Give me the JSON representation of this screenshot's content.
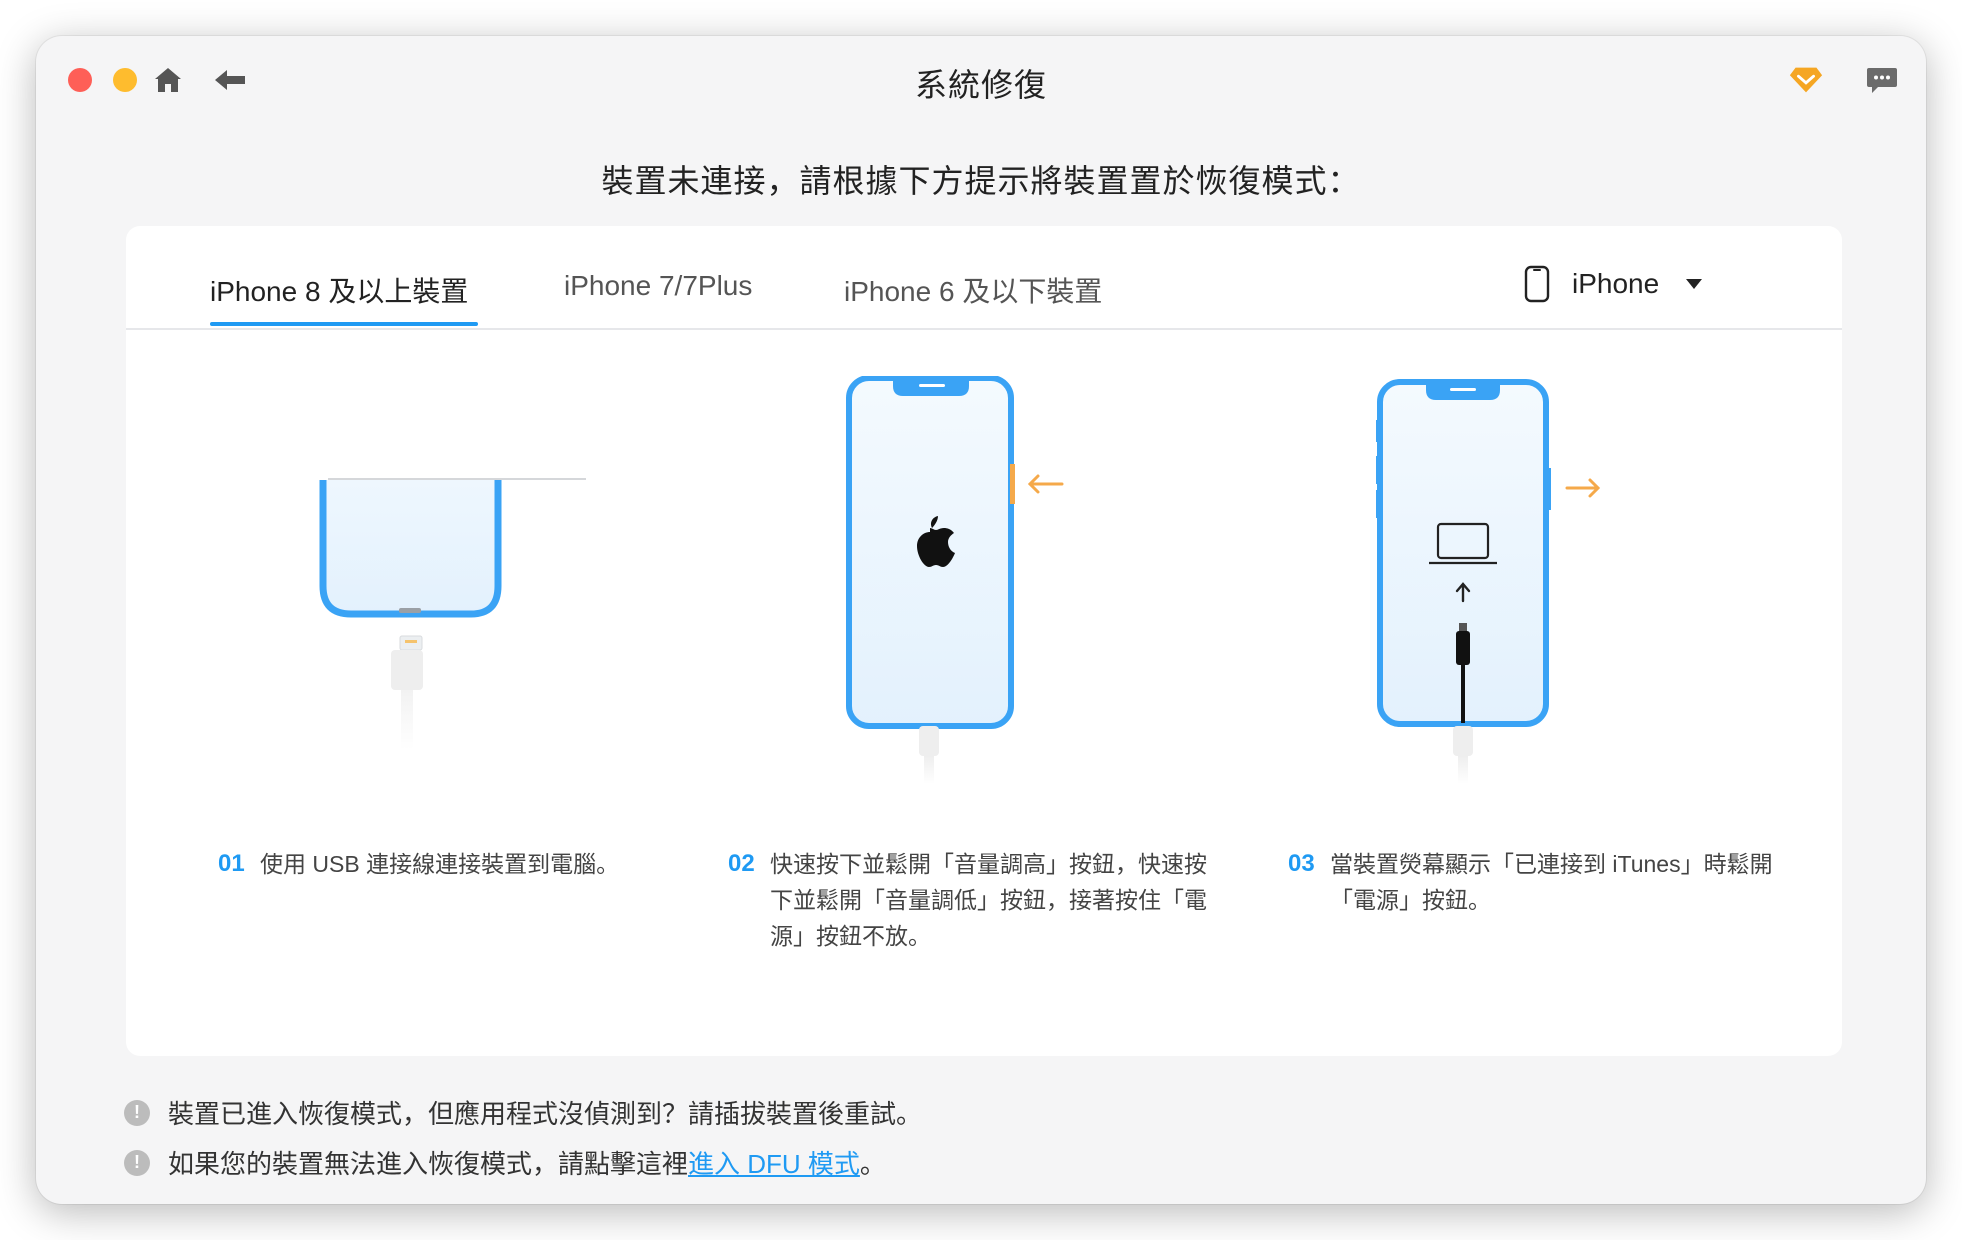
{
  "window": {
    "title": "系統修復"
  },
  "heading": "裝置未連接，請根據下方提示將裝置置於恢復模式：",
  "tabs": [
    {
      "label": "iPhone 8 及以上裝置",
      "active": true
    },
    {
      "label": "iPhone 7/7Plus",
      "active": false
    },
    {
      "label": "iPhone 6 及以下裝置",
      "active": false
    }
  ],
  "device_select": {
    "value": "iPhone"
  },
  "steps": [
    {
      "num": "01",
      "lines": [
        "使用 USB 連接線連接裝置到電腦。"
      ]
    },
    {
      "num": "02",
      "lines": [
        "快速按下並鬆開「音量調高」按鈕，快速按",
        "下並鬆開「音量調低」按鈕，接著按住「電",
        "源」按鈕不放。"
      ]
    },
    {
      "num": "03",
      "lines": [
        "當裝置熒幕顯示「已連接到 iTunes」時鬆開",
        "「電源」按鈕。"
      ]
    }
  ],
  "notes": {
    "note1": "裝置已進入恢復模式，但應用程式沒偵測到？請插拔裝置後重試。",
    "note2_prefix": "如果您的裝置無法進入恢復模式，請點擊這裡",
    "note2_link": "進入 DFU 模式",
    "note2_suffix": "。"
  },
  "colors": {
    "accent": "#1f9af3",
    "phone_border": "#3aa3f5",
    "arrow": "#f5a94a",
    "premium": "#f5a623"
  },
  "icons": [
    "home-icon",
    "back-arrow-icon",
    "premium-diamond-icon",
    "feedback-chat-icon",
    "iphone-icon",
    "dropdown-caret-icon",
    "info-icon"
  ]
}
